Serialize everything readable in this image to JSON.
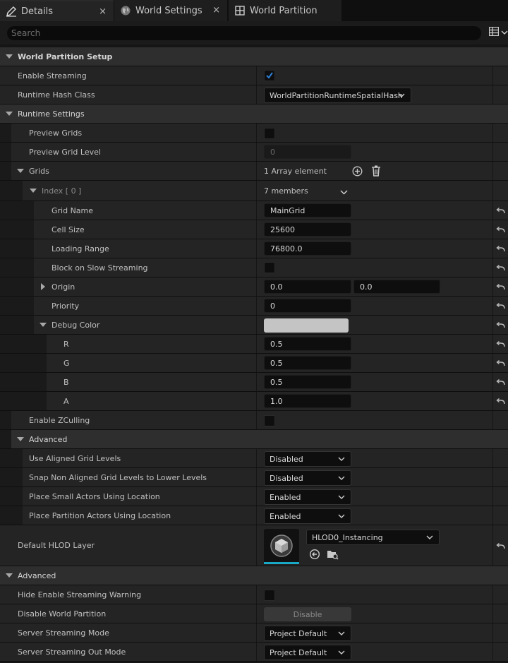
{
  "tabs": [
    {
      "label": "Details",
      "icon": "pencil-icon",
      "active": true,
      "close": "×"
    },
    {
      "label": "World Settings",
      "icon": "globe-icon",
      "active": false,
      "close": "×"
    },
    {
      "label": "World Partition",
      "icon": "grid-icon",
      "active": false
    }
  ],
  "search": {
    "placeholder": "Search"
  },
  "sections": {
    "setup": "World Partition Setup",
    "enable_streaming": "Enable Streaming",
    "runtime_hash_class": "Runtime Hash Class",
    "runtime_hash_value": "WorldPartitionRuntimeSpatialHash",
    "runtime_settings": "Runtime Settings",
    "preview_grids": "Preview Grids",
    "preview_grid_level": "Preview Grid Level",
    "preview_grid_level_value": "0",
    "grids": "Grids",
    "grids_count": "1 Array element",
    "index_label": "Index [ 0 ]",
    "index_members": "7 members",
    "grid_name": "Grid Name",
    "grid_name_value": "MainGrid",
    "cell_size": "Cell Size",
    "cell_size_value": "25600",
    "loading_range": "Loading Range",
    "loading_range_value": "76800.0",
    "block_slow": "Block on Slow Streaming",
    "origin": "Origin",
    "origin_x": "0.0",
    "origin_y": "0.0",
    "priority": "Priority",
    "priority_value": "0",
    "debug_color": "Debug Color",
    "debug_color_hex": "#c4c4c4",
    "r": "R",
    "r_value": "0.5",
    "g": "G",
    "g_value": "0.5",
    "b": "B",
    "b_value": "0.5",
    "a": "A",
    "a_value": "1.0",
    "enable_zculling": "Enable ZCulling",
    "advanced_inner": "Advanced",
    "use_aligned": "Use Aligned Grid Levels",
    "use_aligned_value": "Disabled",
    "snap_non_aligned": "Snap Non Aligned Grid Levels to Lower Levels",
    "snap_non_aligned_value": "Disabled",
    "place_small": "Place Small Actors Using Location",
    "place_small_value": "Enabled",
    "place_partition": "Place Partition Actors Using Location",
    "place_partition_value": "Enabled",
    "default_hlod": "Default HLOD Layer",
    "default_hlod_value": "HLOD0_Instancing",
    "advanced_outer": "Advanced",
    "hide_warning": "Hide Enable Streaming Warning",
    "disable_wp": "Disable World Partition",
    "disable_button": "Disable",
    "server_mode": "Server Streaming Mode",
    "server_mode_value": "Project Default",
    "server_out_mode": "Server Streaming Out Mode",
    "server_out_mode_value": "Project Default"
  },
  "colors": {
    "accent": "#2f7fd8",
    "thumbnail_underline": "#19a9c6"
  }
}
